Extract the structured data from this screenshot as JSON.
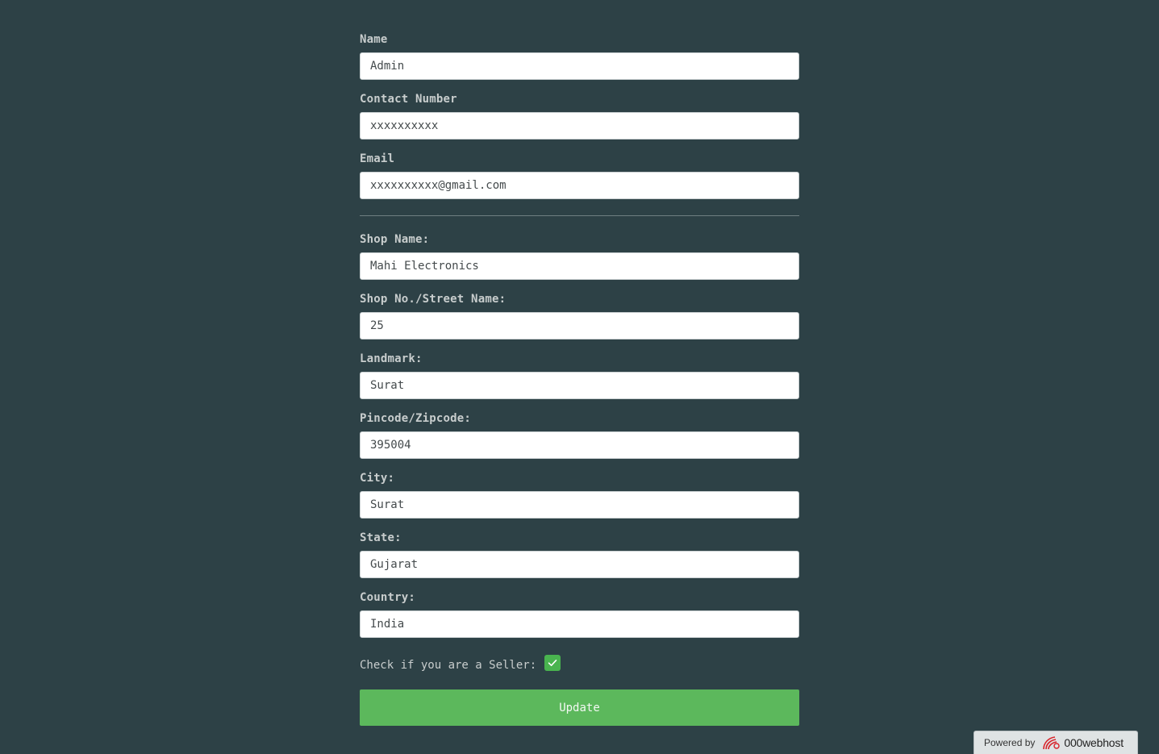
{
  "profile": {
    "fields": [
      {
        "label": "Name",
        "value": "Admin"
      },
      {
        "label": "Contact Number",
        "value": "xxxxxxxxxx"
      },
      {
        "label": "Email",
        "value": "xxxxxxxxxx@gmail.com"
      }
    ]
  },
  "shop": {
    "fields": [
      {
        "label": "Shop Name:",
        "value": "Mahi Electronics"
      },
      {
        "label": "Shop No./Street Name:",
        "value": "25"
      },
      {
        "label": "Landmark:",
        "value": "Surat"
      },
      {
        "label": "Pincode/Zipcode:",
        "value": "395004"
      },
      {
        "label": "City:",
        "value": "Surat"
      },
      {
        "label": "State:",
        "value": "Gujarat"
      },
      {
        "label": "Country:",
        "value": "India"
      }
    ]
  },
  "seller": {
    "label": "Check if you are a Seller:",
    "checked": true
  },
  "actions": {
    "update_label": "Update"
  },
  "footer": {
    "powered_by": "Powered by",
    "brand": "000webhost",
    "brand_icon": "000webhost-logo-icon"
  },
  "colors": {
    "background": "#2d4146",
    "button": "#5cb85c",
    "checkbox": "#49b44f"
  }
}
